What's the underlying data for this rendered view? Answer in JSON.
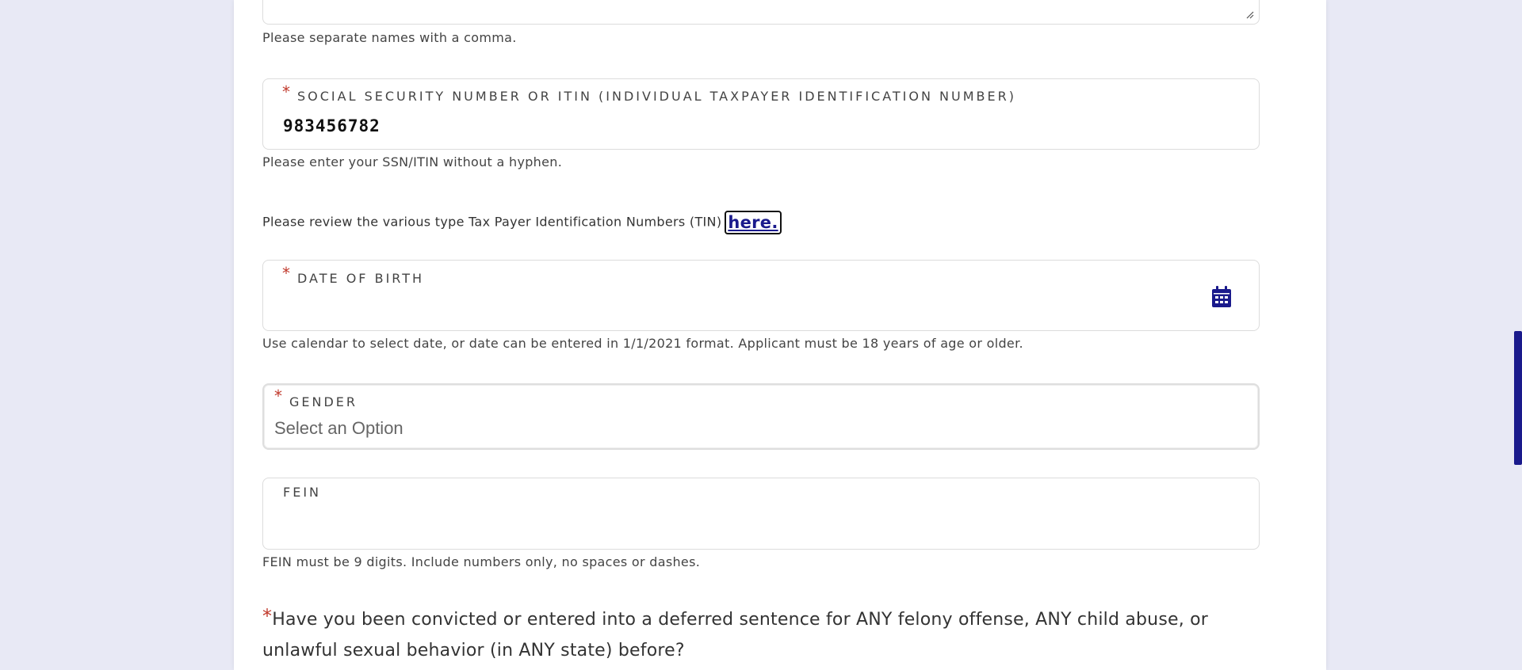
{
  "previous_field": {
    "help_text": "Please separate names with a comma."
  },
  "ssn": {
    "label": "SOCIAL SECURITY NUMBER OR ITIN (INDIVIDUAL TAXPAYER IDENTIFICATION NUMBER)",
    "value": "983456782",
    "required_marker": "*",
    "help_text": "Please enter your SSN/ITIN without a hyphen."
  },
  "tin_review": {
    "text": "Please review the various type Tax Payer Identification Numbers (TIN)",
    "link_label": "here."
  },
  "dob": {
    "label": "DATE OF BIRTH",
    "required_marker": "*",
    "value": "",
    "icon": "calendar-icon",
    "help_text": "Use calendar to select date, or date can be entered in 1/1/2021 format. Applicant must be 18 years of age or older."
  },
  "gender": {
    "label": "GENDER",
    "required_marker": "*",
    "selected": "Select an Option"
  },
  "fein": {
    "label": "FEIN",
    "value": "",
    "help_text": "FEIN must be 9 digits. Include numbers only, no spaces or dashes."
  },
  "question": {
    "required_marker": "*",
    "text": "Have you been convicted or entered into a deferred sentence for ANY felony offense, ANY child abuse, or unlawful sexual behavior (in ANY state) before?"
  },
  "colors": {
    "accent": "#1a1a8c",
    "required": "#c0392b",
    "background": "#e8e9f5"
  }
}
